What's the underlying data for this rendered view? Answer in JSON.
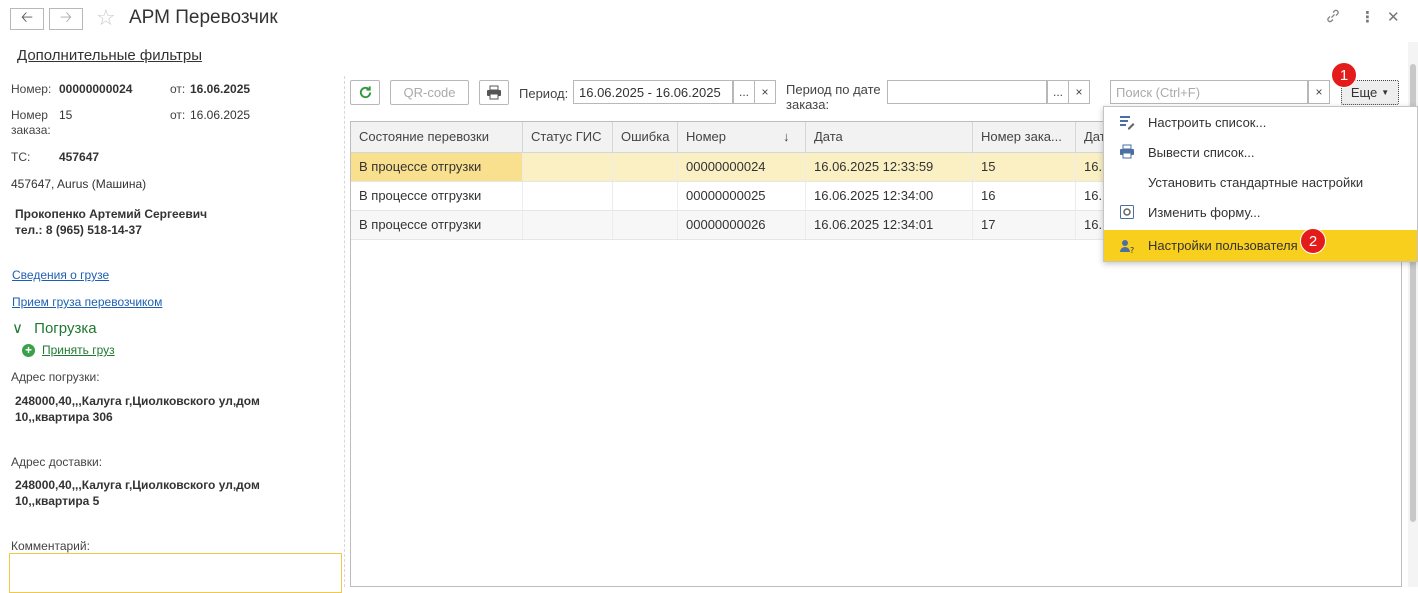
{
  "window": {
    "title": "АРМ Перевозчик"
  },
  "header": {
    "filters_link": "Дополнительные фильтры"
  },
  "left": {
    "number_label": "Номер:",
    "number_value": "00000000024",
    "date1_label": "от:",
    "date1_value": "16.06.2025",
    "order_label_1": "Номер",
    "order_label_2": "заказа:",
    "order_value": "15",
    "date2_label": "от:",
    "date2_value": "16.06.2025",
    "ts_label": "ТС:",
    "ts_value": "457647",
    "vehicle": "457647, Aurus (Машина)",
    "driver_name": "Прокопенко Артемий Сергеевич",
    "driver_phone": "тел.: 8 (965) 518-14-37",
    "cargo_link": "Сведения о грузе",
    "accept_link": "Прием груза перевозчиком",
    "section_title": "Погрузка",
    "accept_cargo": "Принять груз",
    "load_addr_label": "Адрес погрузки:",
    "load_addr_1": "248000,40,,,Калуга г,Циолковского ул,дом",
    "load_addr_2": "10,,квартира 306",
    "del_addr_label": "Адрес доставки:",
    "del_addr_1": "248000,40,,,Калуга г,Циолковского ул,дом",
    "del_addr_2": "10,,квартира 5",
    "comment_label": "Комментарий:"
  },
  "toolbar": {
    "qr_label": "QR-code",
    "period_label": "Период:",
    "period_value": "16.06.2025 - 16.06.2025",
    "dots": "...",
    "clear": "×",
    "period_order_label_1": "Период по дате",
    "period_order_label_2": "заказа:",
    "search_placeholder": "Поиск (Ctrl+F)",
    "more_label": "Еще"
  },
  "table": {
    "columns": [
      "Состояние перевозки",
      "Статус ГИС",
      "Ошибка",
      "Номер",
      "Дата",
      "Номер зака...",
      "Дат"
    ],
    "sort_indicator": "↓",
    "rows": [
      [
        "В процессе отгрузки",
        "",
        "",
        "00000000024",
        "16.06.2025 12:33:59",
        "15",
        "16."
      ],
      [
        "В процессе отгрузки",
        "",
        "",
        "00000000025",
        "16.06.2025 12:34:00",
        "16",
        "16."
      ],
      [
        "В процессе отгрузки",
        "",
        "",
        "00000000026",
        "16.06.2025 12:34:01",
        "17",
        "16."
      ]
    ]
  },
  "menu": {
    "items": [
      {
        "label": "Настроить список...",
        "icon": "list-settings-icon"
      },
      {
        "label": "Вывести список...",
        "icon": "print-list-icon"
      },
      {
        "label": "Установить стандартные настройки",
        "icon": ""
      },
      {
        "label": "Изменить форму...",
        "icon": "form-edit-icon"
      },
      {
        "label": "Настройки пользователя",
        "icon": "user-settings-icon"
      }
    ]
  },
  "badges": {
    "one": "1",
    "two": "2"
  },
  "colors": {
    "selected_row": "#fbf0c4",
    "selected_cell": "#f9e08e",
    "menu_highlight": "#f9cf1e",
    "badge": "#e31b1b",
    "link": "#1e5fb4",
    "green": "#1e7a30"
  }
}
